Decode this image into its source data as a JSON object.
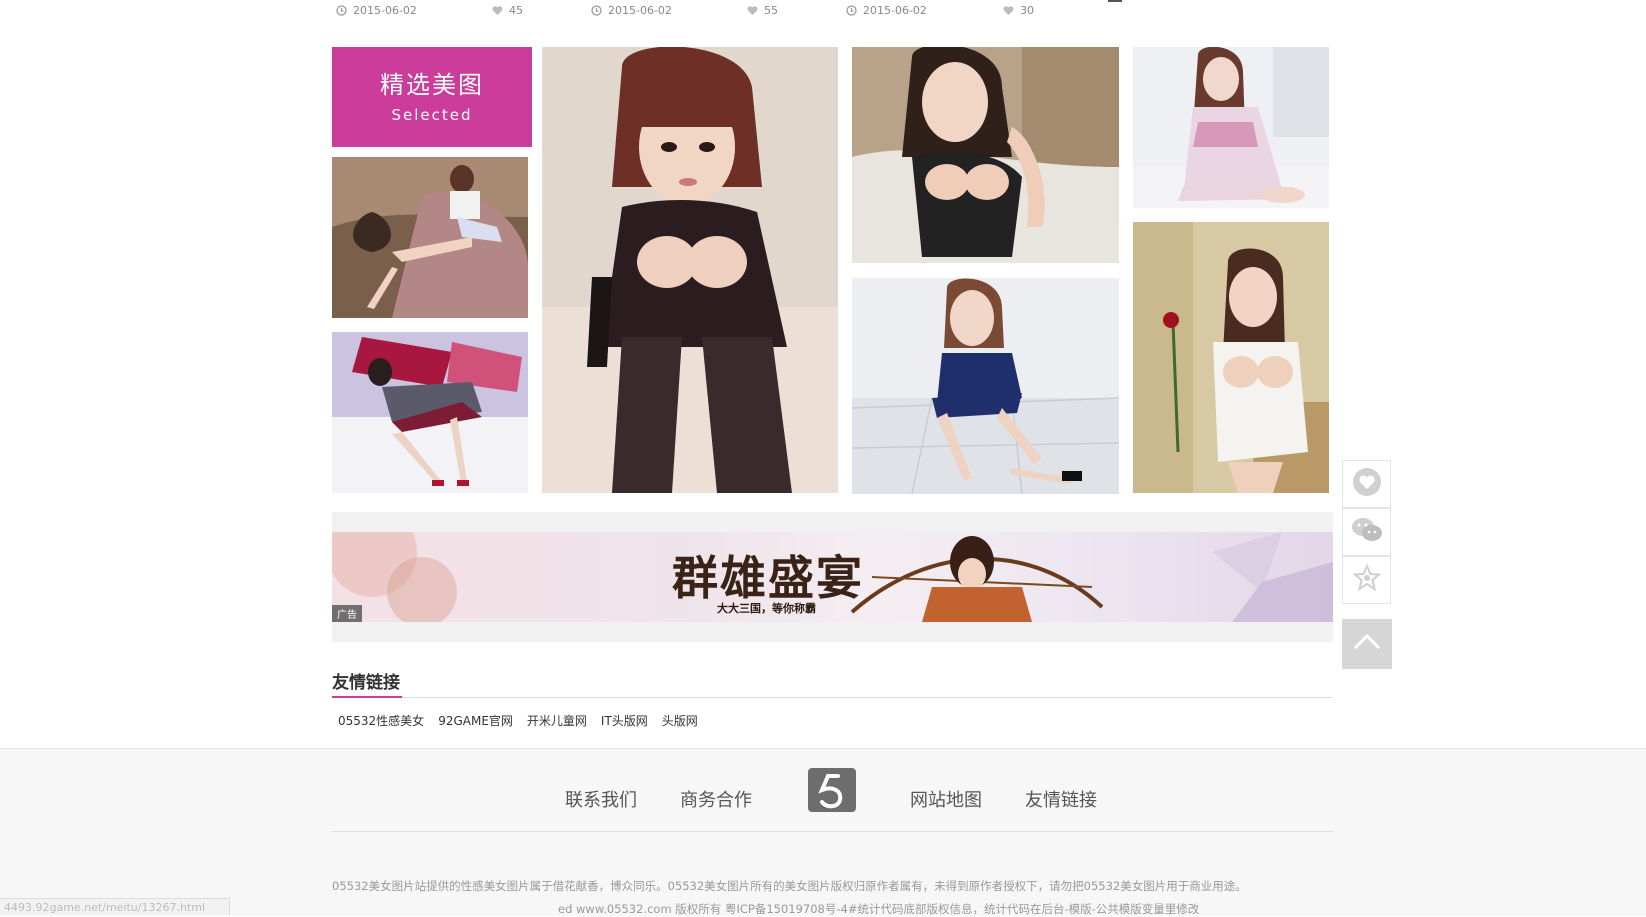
{
  "top_meta": [
    {
      "date": "2015-06-02",
      "likes": "45"
    },
    {
      "date": "2015-06-02",
      "likes": "55"
    },
    {
      "date": "2015-06-02",
      "likes": "30"
    }
  ],
  "selected": {
    "title_cn": "精选美图",
    "title_en": "Selected"
  },
  "ad": {
    "title": "群雄盛宴",
    "subtitle": "大大三国，等你称霸",
    "tag": "广告"
  },
  "friend_links": {
    "title": "友情链接",
    "items": [
      "05532性感美女",
      "92GAME官网",
      "开米儿童网",
      "IT头版网",
      "头版网"
    ]
  },
  "footer": {
    "nav": [
      "联系我们",
      "商务合作",
      "网站地图",
      "友情链接"
    ],
    "description": "05532美女图片站提供的性感美女图片属于借花献香，博众同乐。05532美女图片所有的美女图片版权归原作者属有，未得到原作者授权下，请勿把05532美女图片用于商业用途。",
    "copyright": "ed www.05532.com 版权所有 粤ICP备15019708号-4#统计代码底部版权信息，统计代码在后台-模版-公共模版变量里修改"
  },
  "status_url": "4493.92game.net/meitu/13267.html",
  "side_tools": [
    "heart-icon",
    "wechat-icon",
    "star-icon",
    "back-to-top-icon"
  ],
  "colors": {
    "accent": "#cc3d9b",
    "footer_bg": "#f7f7f7"
  }
}
